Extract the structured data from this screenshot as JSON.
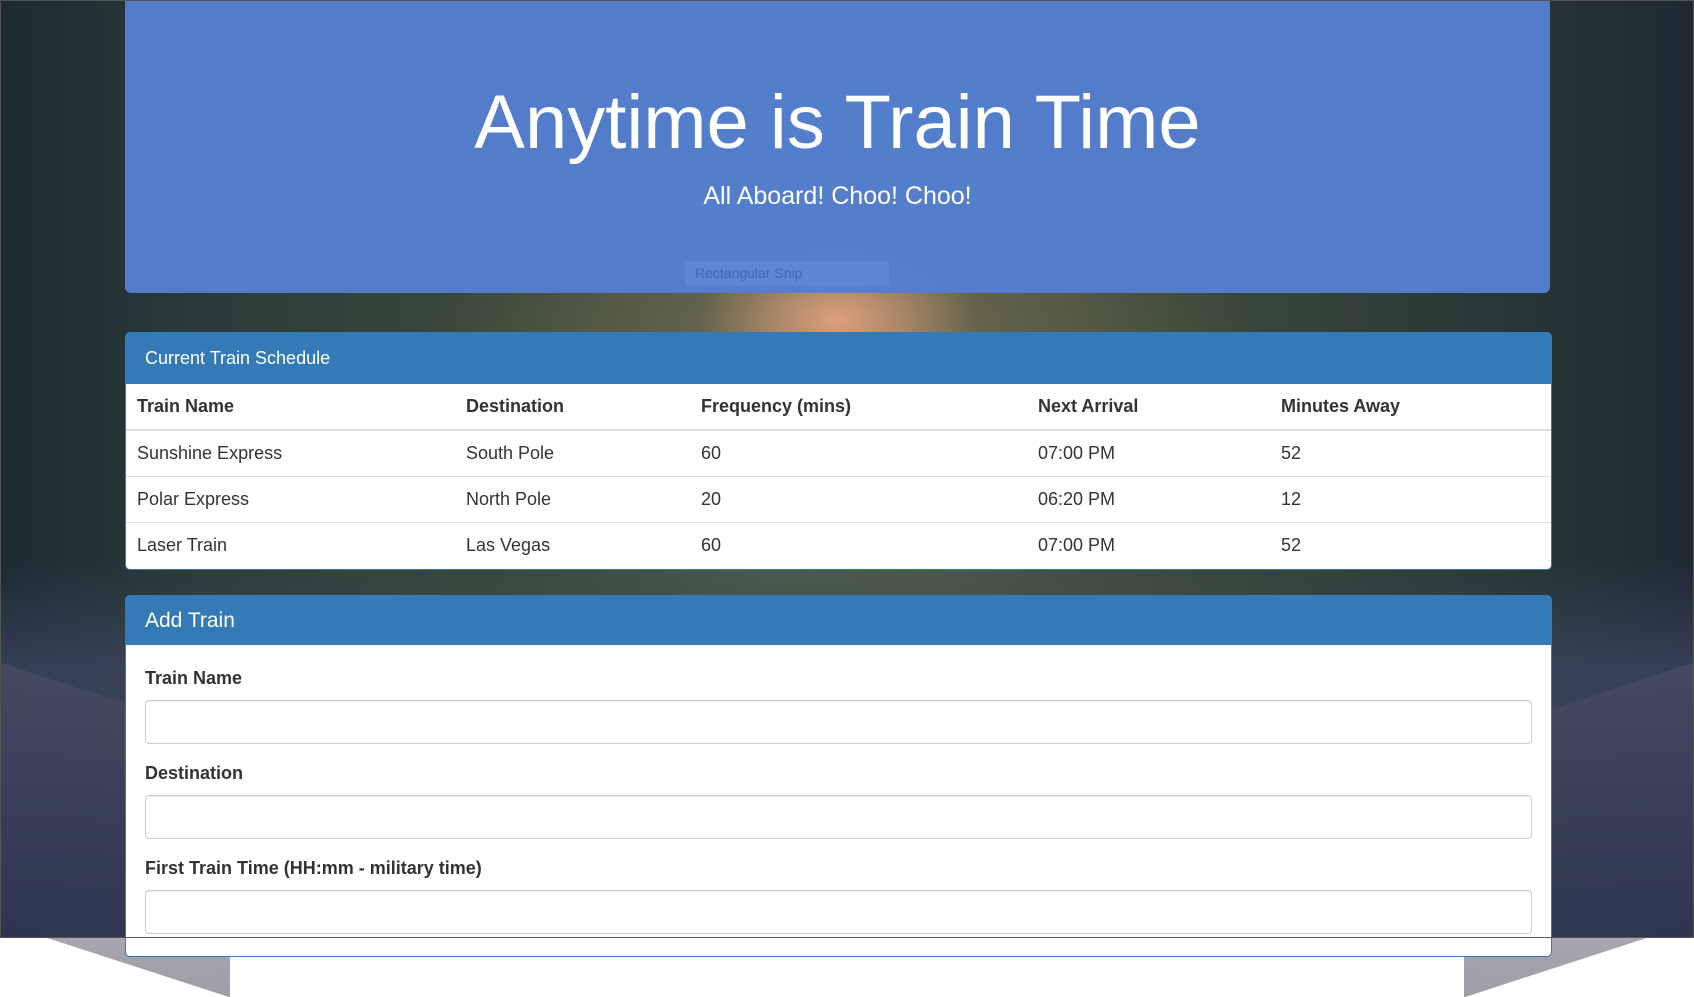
{
  "header": {
    "title": "Anytime is Train Time",
    "subtitle": "All Aboard! Choo! Choo!"
  },
  "overlay": {
    "ghost_label": "Rectangular Snip"
  },
  "schedule": {
    "heading": "Current Train Schedule",
    "columns": [
      "Train Name",
      "Destination",
      "Frequency (mins)",
      "Next Arrival",
      "Minutes Away"
    ],
    "rows": [
      [
        "Sunshine Express",
        "South Pole",
        "60",
        "07:00 PM",
        "52"
      ],
      [
        "Polar Express",
        "North Pole",
        "20",
        "06:20 PM",
        "12"
      ],
      [
        "Laser Train",
        "Las Vegas",
        "60",
        "07:00 PM",
        "52"
      ]
    ]
  },
  "add_train": {
    "heading": "Add Train",
    "fields": [
      {
        "label": "Train Name",
        "value": "",
        "placeholder": ""
      },
      {
        "label": "Destination",
        "value": "",
        "placeholder": ""
      },
      {
        "label": "First Train Time (HH:mm - military time)",
        "value": "",
        "placeholder": ""
      }
    ]
  },
  "colors": {
    "jumbotron": "#547ece",
    "panel_primary": "#337ab7",
    "text": "#333333"
  }
}
